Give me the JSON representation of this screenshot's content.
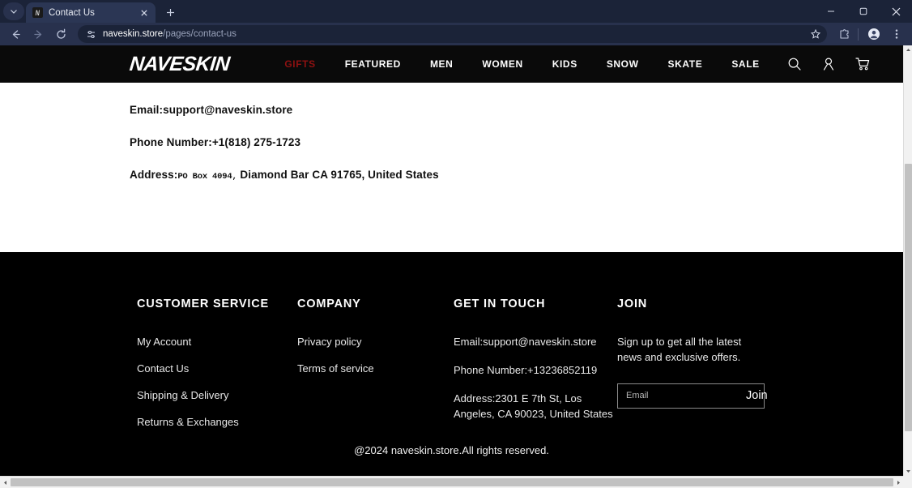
{
  "browser": {
    "tab": {
      "title": "Contact Us",
      "favicon_letter": "N",
      "close_icon": "close-icon"
    },
    "new_tab_label": "+",
    "tab_list_icon": "chevron-down-icon",
    "window_controls": {
      "minimize": "minimize-icon",
      "maximize": "maximize-icon",
      "close": "close-icon"
    },
    "toolbar": {
      "back": "back-arrow-icon",
      "forward": "forward-arrow-icon",
      "reload": "reload-icon",
      "site_info_icon": "site-settings-icon",
      "url_domain": "naveskin.store",
      "url_path": "/pages/contact-us",
      "bookmark_icon": "star-icon",
      "extensions_icon": "extensions-puzzle-icon",
      "profile_icon": "profile-avatar-icon",
      "menu_icon": "three-dot-menu-icon"
    }
  },
  "site": {
    "logo": "NAVESKIN",
    "nav": [
      {
        "label": "GIFTS",
        "accent": true
      },
      {
        "label": "FEATURED",
        "accent": false
      },
      {
        "label": "MEN",
        "accent": false
      },
      {
        "label": "WOMEN",
        "accent": false
      },
      {
        "label": "KIDS",
        "accent": false
      },
      {
        "label": "SNOW",
        "accent": false
      },
      {
        "label": "SKATE",
        "accent": false
      },
      {
        "label": "SALE",
        "accent": false
      }
    ],
    "header_icons": {
      "search": "search-icon",
      "account": "user-account-icon",
      "cart": "shopping-cart-icon"
    },
    "accent_color": "#8f1111"
  },
  "main": {
    "email_label": "Email:",
    "email_value": "support@naveskin.store",
    "phone_label": "Phone Number:",
    "phone_value": "+1(818) 275-1723",
    "address_label": "Address:",
    "address_po": "PO Box 4094,",
    "address_rest": " Diamond Bar CA 91765, United States"
  },
  "footer": {
    "columns": [
      {
        "heading": "CUSTOMER SERVICE",
        "links": [
          "My Account",
          "Contact Us",
          "Shipping & Delivery",
          "Returns & Exchanges"
        ]
      },
      {
        "heading": "COMPANY",
        "links": [
          "Privacy policy",
          "Terms of service"
        ]
      }
    ],
    "get_in_touch": {
      "heading": "GET IN TOUCH",
      "email": "Email:support@naveskin.store",
      "phone": "Phone Number:+13236852119",
      "address_line1": "Address:2301 E 7th St, Los",
      "address_line2": "Angeles, CA 90023, United States"
    },
    "join": {
      "heading": "JOIN",
      "blurb": "Sign up to get all the latest news and exclusive offers.",
      "email_placeholder": "Email",
      "email_value": "",
      "button_label": "Join"
    },
    "copyright": "@2024 naveskin.store.All rights reserved."
  },
  "scrollbars": {
    "vertical_up_icon": "scroll-up-arrow-icon",
    "vertical_down_icon": "scroll-down-arrow-icon",
    "horizontal_left_icon": "scroll-left-arrow-icon",
    "horizontal_right_icon": "scroll-right-arrow-icon"
  }
}
